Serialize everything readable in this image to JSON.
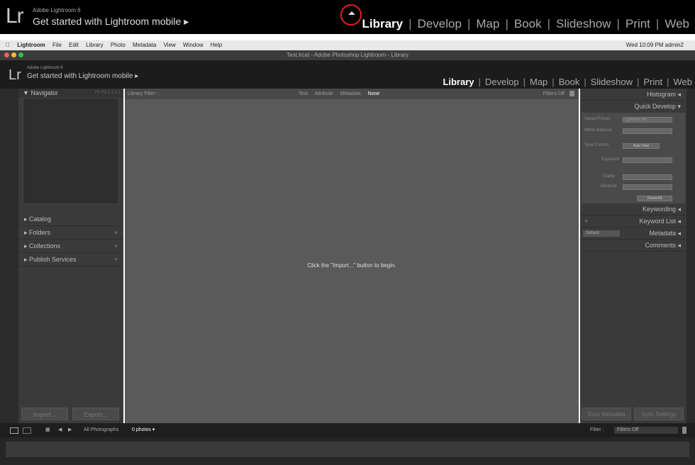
{
  "banner": {
    "sub": "Adobe Lightroom 6",
    "mobile": "Get started with Lightroom mobile  ▸",
    "logo": "Lr"
  },
  "modules": [
    "Library",
    "Develop",
    "Map",
    "Book",
    "Slideshow",
    "Print",
    "Web"
  ],
  "menubar": {
    "items": [
      "Lightroom",
      "File",
      "Edit",
      "Library",
      "Photo",
      "Metadata",
      "View",
      "Window",
      "Help"
    ],
    "status": "Wed 10:09 PM   admin2"
  },
  "titlebar": {
    "title": "Test.lrcat - Adobe Photoshop Lightroom - Library"
  },
  "left": {
    "navigator": "▼ Navigator",
    "nav_zoom": "Fit  Fill  1:1  3:1",
    "items": [
      "Catalog",
      "Folders",
      "Collections",
      "Publish Services"
    ],
    "import": "Import...",
    "export": "Export..."
  },
  "filter": {
    "title": "Library Filter :",
    "opts": [
      "Text",
      "Attribute",
      "Metadata",
      "None"
    ],
    "off": "Filters Off"
  },
  "center": {
    "message": "Click the \"Import...\" button to begin."
  },
  "right": {
    "histogram": "Histogram ◂",
    "quick": "Quick Develop ▾",
    "saved_preset": "Saved Preset",
    "preset_val": "Lightroom Mo...",
    "white_balance": "White Balance",
    "tone": "Tone Control",
    "auto_tone": "Auto Tone",
    "exposure": "Exposure",
    "clarity": "Clarity",
    "vibrance": "Vibrance",
    "reset": "Reset All",
    "keywording": "Keywording ◂",
    "keyword_list": "Keyword List ◂",
    "metadata": "Metadata ◂",
    "metadata_preset": "Default",
    "comments": "Comments ◂",
    "sync_meta": "Sync Metadata",
    "sync_settings": "Sync Settings"
  },
  "bottom": {
    "source": "All Photographs",
    "count": "0 photos ▾",
    "filter_label": "Filter :",
    "filter_val": "Filters Off"
  },
  "colors": {
    "accent": "#e02020"
  }
}
